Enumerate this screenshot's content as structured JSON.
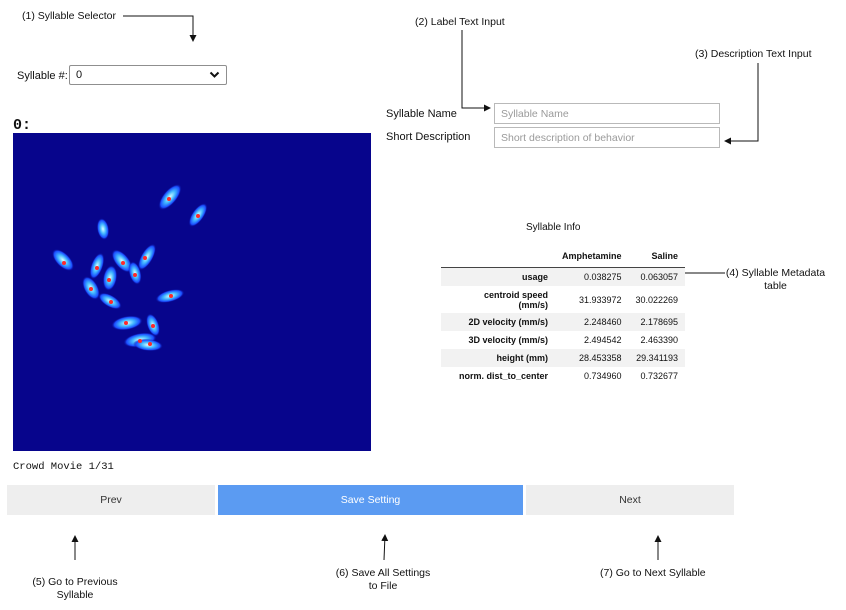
{
  "annotations": {
    "syllable_selector": "(1) Syllable Selector",
    "label_text_input": "(2) Label Text Input",
    "description_text_input": "(3) Description Text Input",
    "metadata_table_line1": "(4) Syllable Metadata",
    "metadata_table_line2": "table",
    "prev_line1": "(5) Go to Previous",
    "prev_line2": "Syllable",
    "save_line1": "(6) Save All Settings",
    "save_line2": "to File",
    "next": "(7) Go to Next Syllable"
  },
  "selector": {
    "label": "Syllable #:",
    "value": "0"
  },
  "form": {
    "name_label": "Syllable Name",
    "name_placeholder": "Syllable Name",
    "desc_label": "Short Description",
    "desc_placeholder": "Short description of behavior"
  },
  "movie": {
    "frame_title": "0:",
    "caption": "Crowd Movie 1/31"
  },
  "info": {
    "title": "Syllable Info",
    "columns": [
      "Amphetamine",
      "Saline"
    ],
    "rows": [
      {
        "label": "usage",
        "values": [
          "0.038275",
          "0.063057"
        ]
      },
      {
        "label_lines": [
          "centroid speed",
          "(mm/s)"
        ],
        "values": [
          "31.933972",
          "30.022269"
        ]
      },
      {
        "label": "2D velocity (mm/s)",
        "values": [
          "2.248460",
          "2.178695"
        ]
      },
      {
        "label": "3D velocity (mm/s)",
        "values": [
          "2.494542",
          "2.463390"
        ]
      },
      {
        "label": "height (mm)",
        "values": [
          "28.453358",
          "29.341193"
        ]
      },
      {
        "label": "norm. dist_to_center",
        "values": [
          "0.734960",
          "0.732677"
        ]
      }
    ]
  },
  "buttons": {
    "prev": "Prev",
    "save": "Save Setting",
    "next": "Next"
  },
  "colors": {
    "movie_background": "#07058c",
    "save_button": "#5b9bf2",
    "nav_button": "#eeeeee"
  },
  "icons": {
    "dropdown": "chevron-down-icon"
  }
}
